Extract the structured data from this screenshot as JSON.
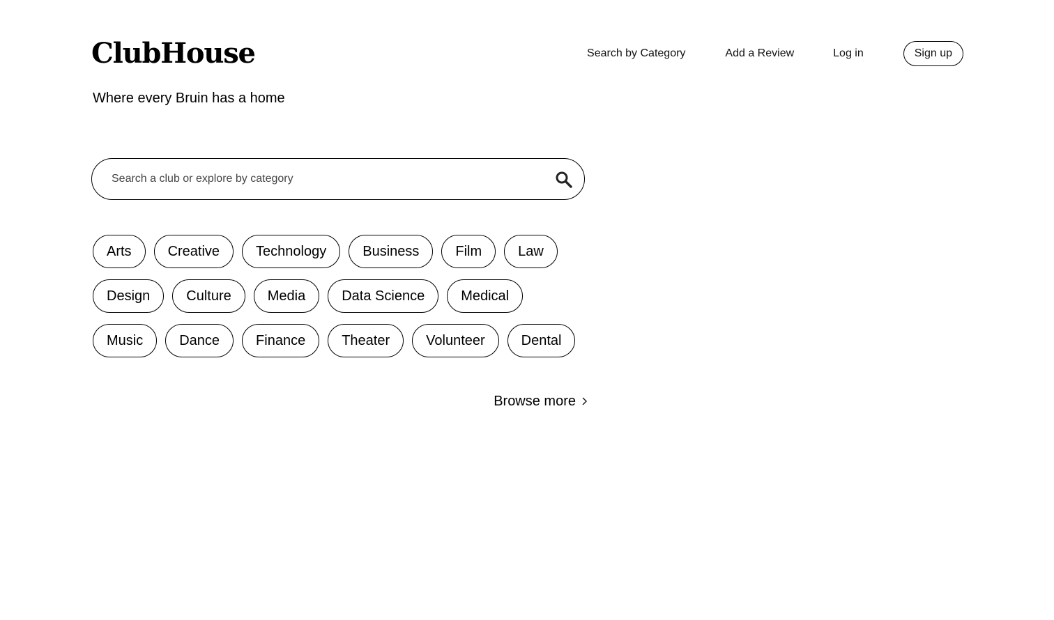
{
  "header": {
    "logo": "ClubHouse",
    "tagline": "Where every Bruin has a home"
  },
  "nav": {
    "search_by_category": "Search by Category",
    "add_review": "Add a Review",
    "login": "Log in",
    "signup": "Sign up"
  },
  "search": {
    "placeholder": "Search a club or explore by category",
    "value": "",
    "icon": "search-icon"
  },
  "categories": [
    [
      "Arts",
      "Creative",
      "Technology",
      "Business",
      "Film",
      "Law"
    ],
    [
      "Design",
      "Culture",
      "Media",
      "Data Science",
      "Medical"
    ],
    [
      "Music",
      "Dance",
      "Finance",
      "Theater",
      "Volunteer",
      "Dental"
    ]
  ],
  "browse": {
    "label": "Browse more",
    "icon": "chevron-right-icon"
  }
}
